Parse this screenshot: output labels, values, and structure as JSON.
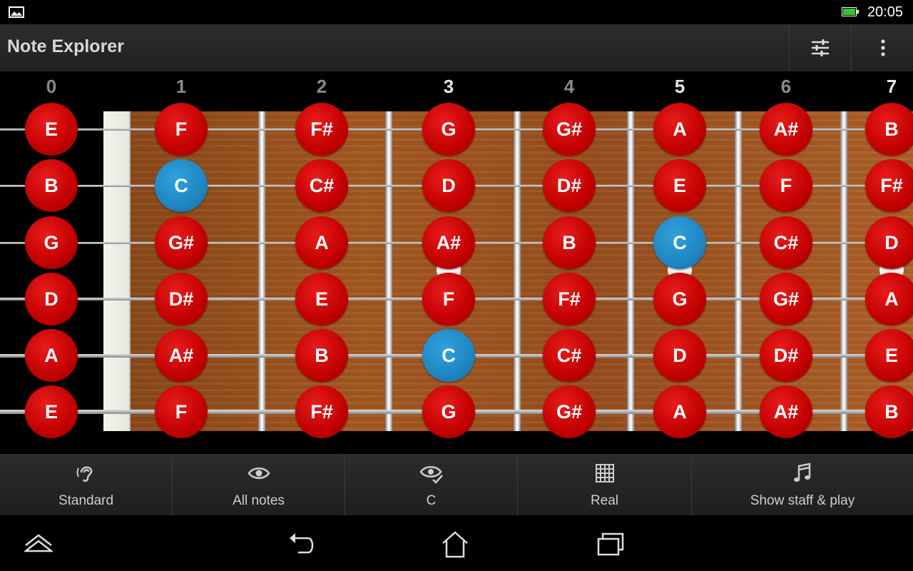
{
  "status": {
    "time": "20:05",
    "notification_icon": "image-icon",
    "battery_icon": "battery-icon",
    "battery_color": "#35c82c"
  },
  "app": {
    "title": "Note Explorer",
    "actions": [
      "settings-sliders-icon",
      "overflow-menu-icon"
    ]
  },
  "fretboard": {
    "fret_numbers": [
      "0",
      "1",
      "2",
      "3",
      "4",
      "5",
      "6",
      "7"
    ],
    "marked_frets": [
      3,
      5,
      7
    ],
    "highlight_note": "C",
    "colors": {
      "note": "#c80000",
      "highlight": "#1f86c2"
    },
    "strings": [
      [
        "E",
        "F",
        "F#",
        "G",
        "G#",
        "A",
        "A#",
        "B"
      ],
      [
        "B",
        "C",
        "C#",
        "D",
        "D#",
        "E",
        "F",
        "F#"
      ],
      [
        "G",
        "G#",
        "A",
        "A#",
        "B",
        "C",
        "C#",
        "D"
      ],
      [
        "D",
        "D#",
        "E",
        "F",
        "F#",
        "G",
        "G#",
        "A"
      ],
      [
        "A",
        "A#",
        "B",
        "C",
        "C#",
        "D",
        "D#",
        "E"
      ],
      [
        "E",
        "F",
        "F#",
        "G",
        "G#",
        "A",
        "A#",
        "B"
      ]
    ]
  },
  "tabs": [
    {
      "icon": "ear-icon",
      "label": "Standard"
    },
    {
      "icon": "eye-icon",
      "label": "All notes"
    },
    {
      "icon": "eye-check-icon",
      "label": "C"
    },
    {
      "icon": "grid-icon",
      "label": "Real"
    },
    {
      "icon": "music-note-icon",
      "label": "Show staff & play"
    }
  ],
  "nav": [
    "up-icon",
    "back-icon",
    "home-icon",
    "recent-apps-icon"
  ]
}
